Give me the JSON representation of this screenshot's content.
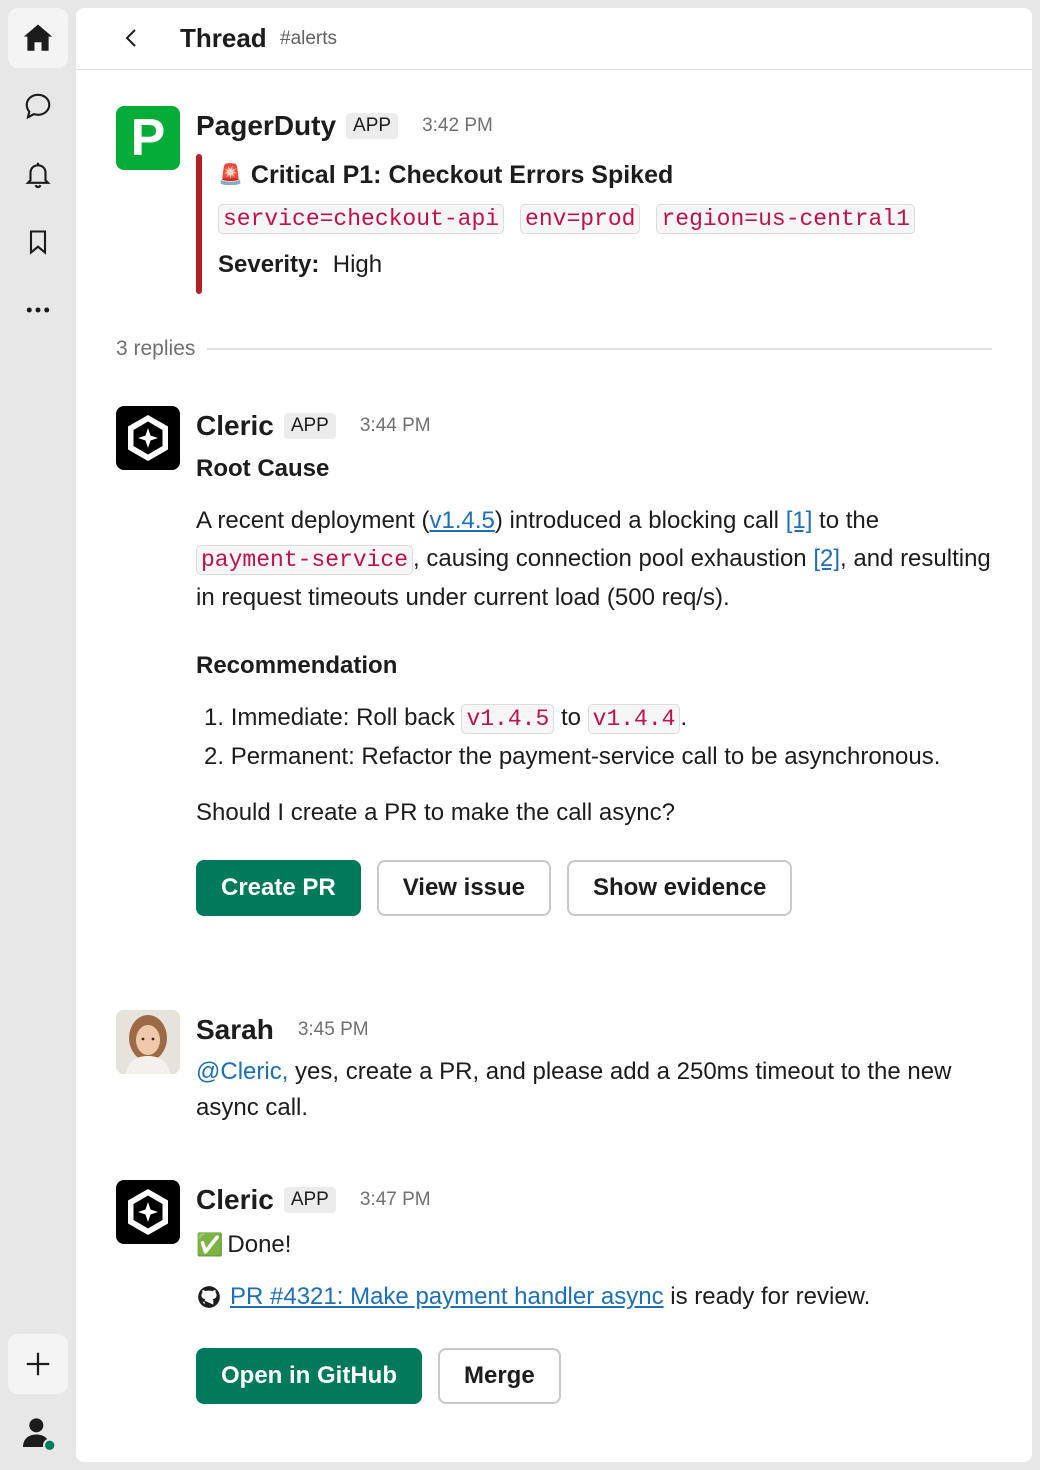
{
  "header": {
    "title": "Thread",
    "channel": "#alerts"
  },
  "rail": {
    "items": [
      "home-icon",
      "chat-icon",
      "bell-icon",
      "bookmark-icon",
      "more-icon"
    ],
    "add": "plus-icon",
    "profile": "user-icon",
    "status_color": "#007a5a"
  },
  "alert": {
    "author": "PagerDuty",
    "tag": "APP",
    "time": "3:42 PM",
    "avatar_letter": "P",
    "avatar_color": "#06ac38",
    "emoji": "🚨",
    "title": "Critical P1: Checkout Errors Spiked",
    "labels": [
      "service=checkout-api",
      "env=prod",
      "region=us-central1"
    ],
    "severity_label": "Severity:",
    "severity_value": "High",
    "bar_color": "#b21f24"
  },
  "replies_count": "3 replies",
  "cleric1": {
    "author": "Cleric",
    "tag": "APP",
    "time": "3:44 PM",
    "root_heading": "Root Cause",
    "rc_1": "A recent deployment (",
    "rc_version": "v1.4.5",
    "rc_2": ") introduced a blocking call ",
    "rc_ref1": "[1]",
    "rc_3": " to the",
    "rc_code": "payment-service",
    "rc_4": ", causing connection pool exhaustion ",
    "rc_ref2": "[2]",
    "rc_5": ", and resulting in request timeouts under current load (500 req/s).",
    "rec_heading": "Recommendation",
    "rec1_num": "1.",
    "rec1_text": "Immediate: Roll back ",
    "rec1_code1": "v1.4.5",
    "rec1_to": " to ",
    "rec1_code2": "v1.4.4",
    "rec1_end": ".",
    "rec2_num": "2.",
    "rec2_text": "Permanent: Refactor the payment-service call to be asynchronous.",
    "question": "Should I create a PR to make the call async?",
    "btn_create": "Create PR",
    "btn_view": "View issue",
    "btn_evidence": "Show evidence"
  },
  "sarah": {
    "author": "Sarah",
    "time": "3:45 PM",
    "mention": "@Cleric,",
    "text": " yes, create a PR, and please add a 250ms timeout to the new async call."
  },
  "cleric2": {
    "author": "Cleric",
    "tag": "APP",
    "time": "3:47 PM",
    "check_emoji": "✅",
    "done": "Done!",
    "pr_link": "PR #4321: Make payment handler async",
    "pr_suffix": " is ready for review.",
    "btn_github": "Open in GitHub",
    "btn_merge": "Merge"
  },
  "colors": {
    "accent_green": "#007a5a",
    "link": "#1d6fb8",
    "code_text": "#c0114a"
  }
}
